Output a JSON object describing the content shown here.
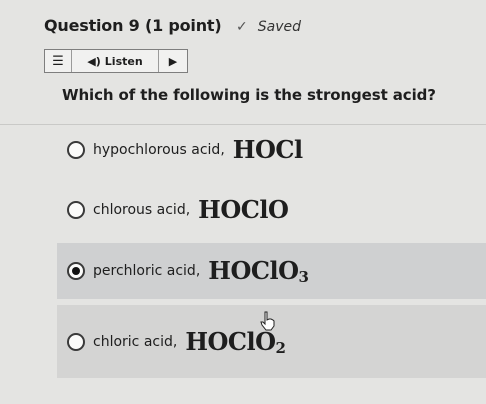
{
  "header": {
    "question_title": "Question 9 (1 point)",
    "saved_label": "Saved"
  },
  "toolbar": {
    "listen_label": "Listen"
  },
  "question": {
    "text": "Which of the following is the strongest acid?"
  },
  "options": [
    {
      "name": "hypochlorous acid,",
      "formula": "HOCl",
      "subscript": "",
      "selected": false
    },
    {
      "name": "chlorous acid,",
      "formula": "HOClO",
      "subscript": "",
      "selected": false
    },
    {
      "name": "perchloric acid,",
      "formula": "HOClO",
      "subscript": "3",
      "selected": true
    },
    {
      "name": "chloric acid,",
      "formula": "HOClO",
      "subscript": "2",
      "selected": false
    }
  ],
  "icons": {
    "saved": "checkmark-icon",
    "menu": "menu-icon",
    "listen": "speaker-icon",
    "play": "play-icon",
    "cursor": "hand-pointer-icon"
  }
}
